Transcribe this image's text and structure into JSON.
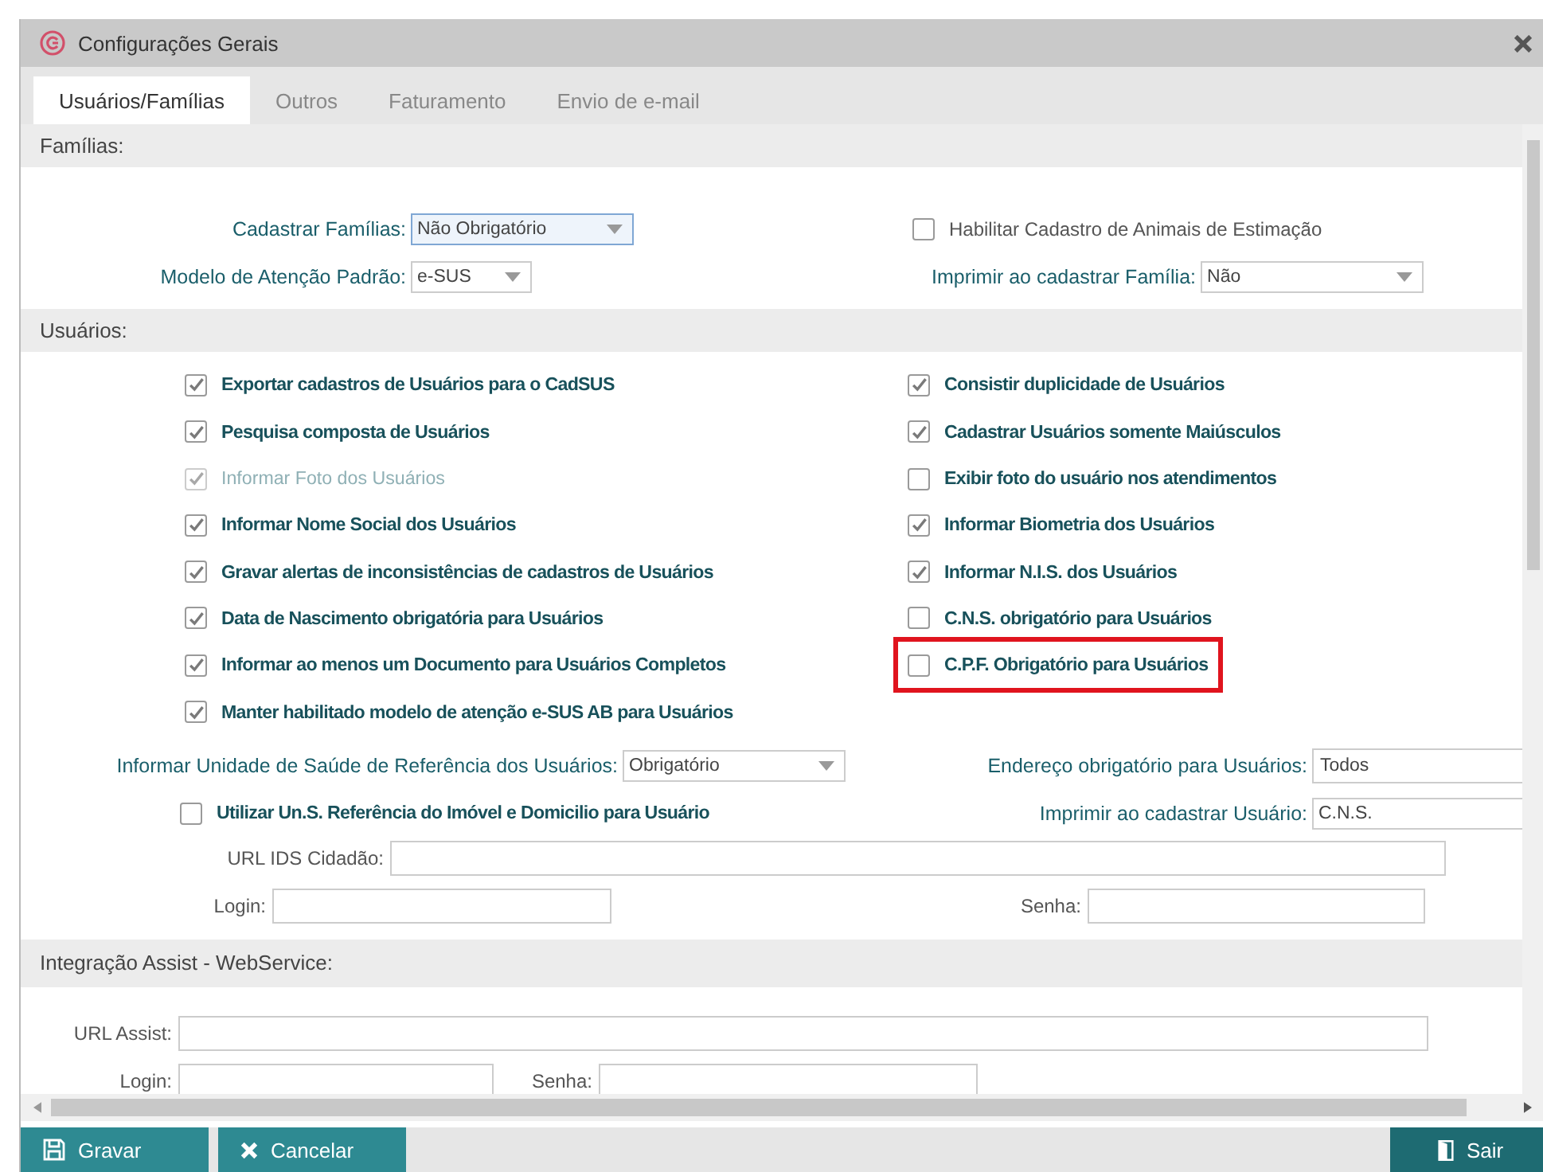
{
  "window": {
    "title": "Configurações Gerais"
  },
  "tabs": [
    {
      "label": "Usuários/Famílias",
      "selected": true
    },
    {
      "label": "Outros",
      "selected": false
    },
    {
      "label": "Faturamento",
      "selected": false
    },
    {
      "label": "Envio de e-mail",
      "selected": false
    }
  ],
  "families": {
    "header": "Famílias:",
    "cadastrar": {
      "label": "Cadastrar Famílias:",
      "value": "Não Obrigatório",
      "focused": true
    },
    "modelo": {
      "label": "Modelo de Atenção Padrão:",
      "value": "e-SUS",
      "focused": false
    },
    "animais": {
      "label": "Habilitar Cadastro de Animais de Estimação",
      "checked": false
    },
    "imprimir": {
      "label": "Imprimir ao cadastrar Família:",
      "value": "Não",
      "focused": false
    }
  },
  "users": {
    "header": "Usuários:",
    "options_left": [
      {
        "label": "Exportar cadastros de Usuários para o CadSUS",
        "checked": true,
        "disabled": false,
        "highlighted": false
      },
      {
        "label": "Pesquisa composta de Usuários",
        "checked": true,
        "disabled": false,
        "highlighted": false
      },
      {
        "label": "Informar Foto dos Usuários",
        "checked": true,
        "disabled": true,
        "highlighted": false
      },
      {
        "label": "Informar Nome Social dos Usuários",
        "checked": true,
        "disabled": false,
        "highlighted": false
      },
      {
        "label": "Gravar alertas de inconsistências de cadastros de Usuários",
        "checked": true,
        "disabled": false,
        "highlighted": false
      },
      {
        "label": "Data de Nascimento obrigatória para Usuários",
        "checked": true,
        "disabled": false,
        "highlighted": false
      },
      {
        "label": "Informar ao menos um Documento para Usuários Completos",
        "checked": true,
        "disabled": false,
        "highlighted": false
      },
      {
        "label": "Manter habilitado modelo de atenção e-SUS AB para Usuários",
        "checked": true,
        "disabled": false,
        "highlighted": false
      }
    ],
    "options_right": [
      {
        "label": "Consistir duplicidade de Usuários",
        "checked": true,
        "disabled": false,
        "highlighted": false
      },
      {
        "label": "Cadastrar Usuários somente Maiúsculos",
        "checked": true,
        "disabled": false,
        "highlighted": false
      },
      {
        "label": "Exibir foto do usuário nos atendimentos",
        "checked": false,
        "disabled": false,
        "highlighted": false
      },
      {
        "label": "Informar Biometria dos Usuários",
        "checked": true,
        "disabled": false,
        "highlighted": false
      },
      {
        "label": "Informar N.I.S. dos Usuários",
        "checked": true,
        "disabled": false,
        "highlighted": false
      },
      {
        "label": "C.N.S. obrigatório para Usuários",
        "checked": false,
        "disabled": false,
        "highlighted": false
      },
      {
        "label": "C.P.F. Obrigatório para Usuários",
        "checked": false,
        "disabled": false,
        "highlighted": true
      }
    ],
    "unidade": {
      "label": "Informar Unidade de Saúde de Referência dos Usuários:",
      "value": "Obrigatório",
      "focused": false
    },
    "endereco": {
      "label": "Endereço obrigatório para Usuários:",
      "value": "Todos"
    },
    "utilizar": {
      "label": "Utilizar Un.S. Referência do Imóvel e Domicilio para Usuário",
      "checked": false
    },
    "imprimir": {
      "label": "Imprimir ao cadastrar Usuário:",
      "value": "C.N.S.",
      "focused": false
    },
    "url_ids": {
      "label": "URL IDS Cidadão:"
    },
    "login": {
      "label": "Login:"
    },
    "senha": {
      "label": "Senha:"
    }
  },
  "integration": {
    "header": "Integração Assist - WebService:",
    "url": {
      "label": "URL Assist:"
    },
    "login": {
      "label": "Login:"
    },
    "senha": {
      "label": "Senha:"
    }
  },
  "buttons": [
    {
      "label": "Gravar",
      "kind": "save"
    },
    {
      "label": "Cancelar",
      "kind": "cancel"
    },
    {
      "label": "Sair",
      "kind": "exit"
    }
  ]
}
